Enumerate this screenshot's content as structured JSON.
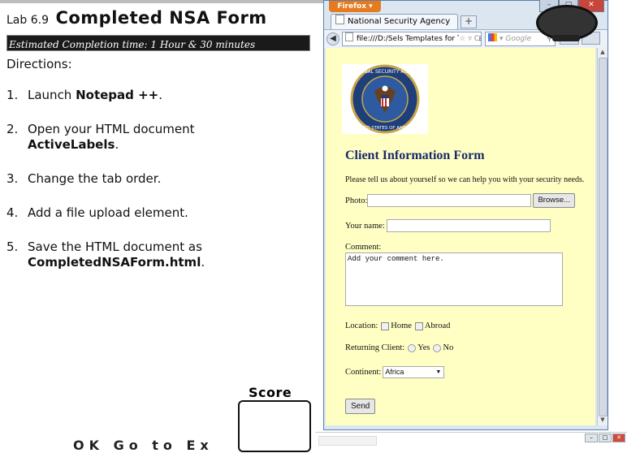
{
  "lab": {
    "number": "Lab 6.9",
    "title": "Completed NSA Form",
    "estimated_time": "Estimated Completion time: 1 Hour & 30 minutes",
    "directions_label": "Directions:",
    "steps": [
      {
        "num": "1.",
        "text_before": "Launch ",
        "bold": "Notepad ++",
        "text_after": "."
      },
      {
        "num": "2.",
        "text_before": "Open your HTML document ",
        "bold": "ActiveLabels",
        "text_after": "."
      },
      {
        "num": "3.",
        "text_before": "Change the tab order.",
        "bold": "",
        "text_after": ""
      },
      {
        "num": "4.",
        "text_before": "Add a file upload element.",
        "bold": "",
        "text_after": ""
      },
      {
        "num": "5.",
        "text_before": "Save the HTML document as ",
        "bold": "CompletedNSAForm.html",
        "text_after": "."
      }
    ],
    "score_label": "Score",
    "cut_text": "OK Go to Ex"
  },
  "browser": {
    "app_button": "Firefox",
    "tab_title": "National Security Agency",
    "new_tab": "+",
    "url": "file:///D:/Sels Templates for Teacher",
    "search_placeholder": "Google",
    "icons": {
      "back": "back-arrow-icon",
      "star": "bookmark-star-icon",
      "reload": "reload-icon",
      "search": "magnifier-icon"
    }
  },
  "page": {
    "heading": "Client Information Form",
    "intro": "Please tell us about yourself so we can help you with your security needs.",
    "photo_label": "Photo:",
    "browse_label": "Browse...",
    "name_label": "Your name:",
    "comment_label": "Comment:",
    "comment_value": "Add your comment here.",
    "location_label": "Location:",
    "location_options": [
      "Home",
      "Abroad"
    ],
    "returning_label": "Returning Client:",
    "returning_options": [
      "Yes",
      "No"
    ],
    "continent_label": "Continent:",
    "continent_value": "Africa",
    "send_label": "Send",
    "logo_text_top": "NATIONAL SECURITY AGENCY",
    "logo_text_bottom": "UNITED STATES OF AMERICA"
  },
  "colors": {
    "page_bg": "#ffffc4",
    "heading": "#1a2b6b",
    "firefox_orange": "#e57a1f",
    "window_frame": "#dce6f1"
  }
}
